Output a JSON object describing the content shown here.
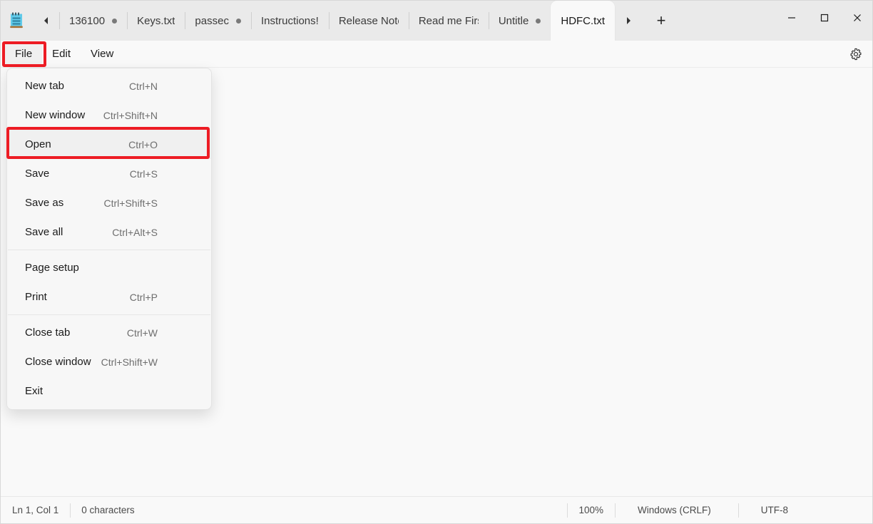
{
  "window": {
    "app_name": "Notepad",
    "app_icon": "notepad-icon",
    "controls": {
      "minimize": "─",
      "maximize": "□",
      "close": "✕"
    }
  },
  "tabbar": {
    "scroll_left_icon": "◀",
    "scroll_right_icon": "▶",
    "new_tab_icon": "+",
    "tabs": [
      {
        "label": "136100",
        "dirty": true,
        "active": false
      },
      {
        "label": "Keys.txt",
        "dirty": false,
        "active": false
      },
      {
        "label": "passec",
        "dirty": true,
        "active": false
      },
      {
        "label": "Instructions!",
        "dirty": false,
        "active": false
      },
      {
        "label": "Release Note",
        "dirty": false,
        "active": false
      },
      {
        "label": "Read me Firs",
        "dirty": false,
        "active": false
      },
      {
        "label": "Untitle",
        "dirty": true,
        "active": false
      },
      {
        "label": "HDFC.txt",
        "dirty": false,
        "active": true
      }
    ]
  },
  "menubar": {
    "items": [
      {
        "label": "File",
        "opened": true
      },
      {
        "label": "Edit",
        "opened": false
      },
      {
        "label": "View",
        "opened": false
      }
    ],
    "settings_icon": "gear-icon"
  },
  "file_menu": {
    "groups": [
      {
        "items": [
          {
            "label": "New tab",
            "accel": "Ctrl+N",
            "selected": false
          },
          {
            "label": "New window",
            "accel": "Ctrl+Shift+N",
            "selected": false
          },
          {
            "label": "Open",
            "accel": "Ctrl+O",
            "selected": true
          },
          {
            "label": "Save",
            "accel": "Ctrl+S",
            "selected": false
          },
          {
            "label": "Save as",
            "accel": "Ctrl+Shift+S",
            "selected": false
          },
          {
            "label": "Save all",
            "accel": "Ctrl+Alt+S",
            "selected": false
          }
        ]
      },
      {
        "items": [
          {
            "label": "Page setup",
            "accel": "",
            "selected": false
          },
          {
            "label": "Print",
            "accel": "Ctrl+P",
            "selected": false
          }
        ]
      },
      {
        "items": [
          {
            "label": "Close tab",
            "accel": "Ctrl+W",
            "selected": false
          },
          {
            "label": "Close window",
            "accel": "Ctrl+Shift+W",
            "selected": false
          },
          {
            "label": "Exit",
            "accel": "",
            "selected": false
          }
        ]
      }
    ]
  },
  "editor": {
    "content": ""
  },
  "statusbar": {
    "cursor": "Ln 1, Col 1",
    "characters": "0 characters",
    "zoom": "100%",
    "line_endings": "Windows (CRLF)",
    "encoding": "UTF-8"
  },
  "highlights": {
    "color": "#ed1c24",
    "targets": [
      "File",
      "Open"
    ]
  }
}
